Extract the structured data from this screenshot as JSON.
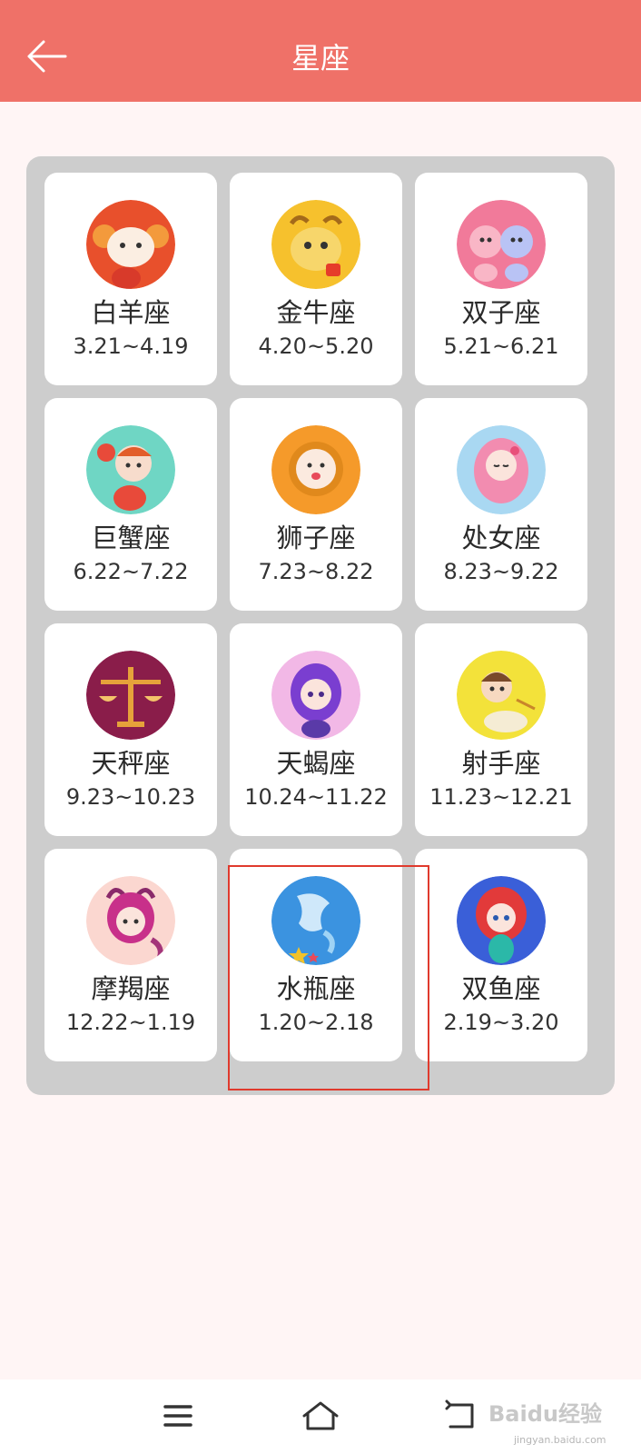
{
  "header": {
    "title": "星座"
  },
  "zodiac": [
    {
      "name": "白羊座",
      "date": "3.21~4.19"
    },
    {
      "name": "金牛座",
      "date": "4.20~5.20"
    },
    {
      "name": "双子座",
      "date": "5.21~6.21"
    },
    {
      "name": "巨蟹座",
      "date": "6.22~7.22"
    },
    {
      "name": "狮子座",
      "date": "7.23~8.22"
    },
    {
      "name": "处女座",
      "date": "8.23~9.22"
    },
    {
      "name": "天秤座",
      "date": "9.23~10.23"
    },
    {
      "name": "天蝎座",
      "date": "10.24~11.22"
    },
    {
      "name": "射手座",
      "date": "11.23~12.21"
    },
    {
      "name": "摩羯座",
      "date": "12.22~1.19"
    },
    {
      "name": "水瓶座",
      "date": "1.20~2.18"
    },
    {
      "name": "双鱼座",
      "date": "2.19~3.20"
    }
  ],
  "watermark": {
    "main": "Baidu经验",
    "sub": "jingyan.baidu.com"
  },
  "colors": {
    "header": "#ef7168",
    "background": "#fff5f5",
    "panel": "#cdcdcd",
    "highlight": "#e03a2d"
  }
}
